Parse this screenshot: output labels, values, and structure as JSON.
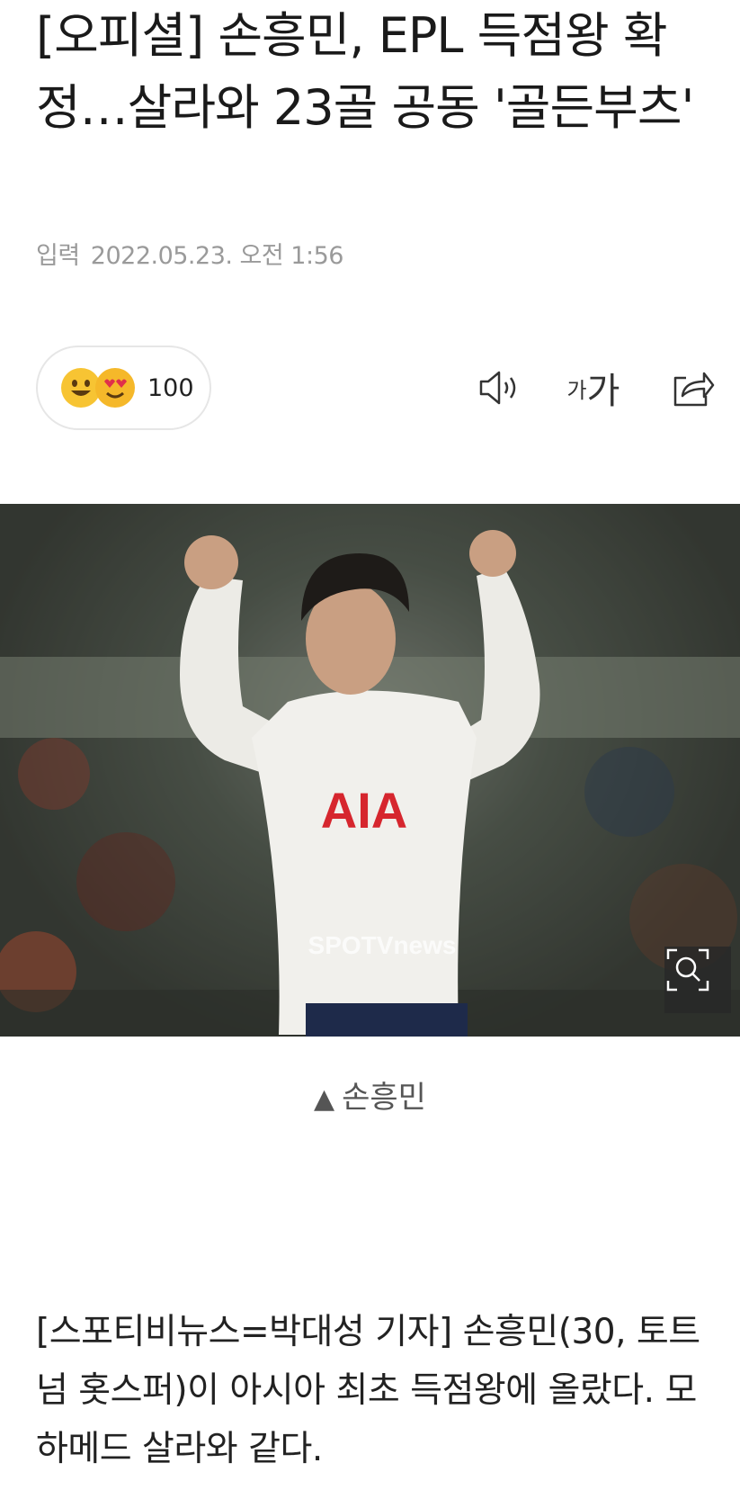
{
  "article": {
    "headline": "[오피셜] 손흥민, EPL 득점왕 확정…살라와 23골 공동 '골든부츠'",
    "date_label": "입력",
    "date_value": "2022.05.23. 오전 1:56",
    "reaction_count": "100",
    "font_toggle_small": "가",
    "font_toggle_large": "가",
    "photo_watermark": "SPOTVnews",
    "photo_jersey_text": "AIA",
    "photo_caption": "손흥민",
    "body": "[스포티비뉴스=박대성 기자] 손흥민(30, 토트넘 홋스퍼)이 아시아 최초 득점왕에 올랐다. 모하메드 살라와 같다."
  },
  "icons": {
    "emoji_1": "grinning-face-icon",
    "emoji_2": "heart-eyes-face-icon",
    "speaker": "speaker-icon",
    "font_size": "font-size-icon",
    "share": "share-icon",
    "zoom": "zoom-search-icon",
    "caption_marker": "triangle-up-icon"
  },
  "colors": {
    "emoji_yellow": "#f7c433",
    "caption_gray": "#555555",
    "date_gray": "#9a9a9a",
    "jersey_red": "#d6262e"
  }
}
